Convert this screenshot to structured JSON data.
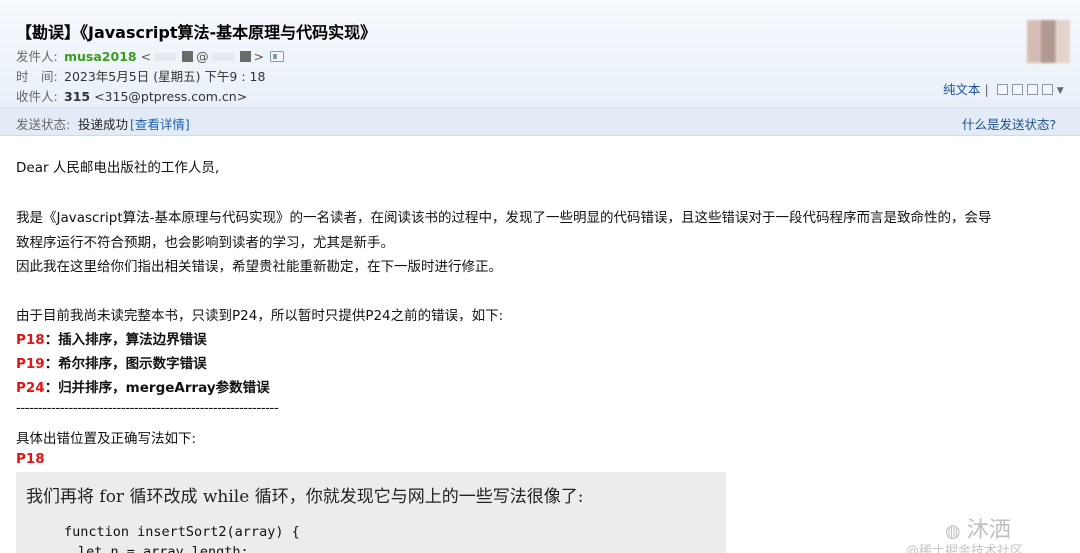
{
  "email": {
    "subject": "【勘误】《Javascript算法-基本原理与代码实现》",
    "star": "☆",
    "sender_label": "发件人:",
    "sender_name": "musa2018",
    "sender_addr_open": "<",
    "sender_at": "@",
    "sender_addr_close": ">",
    "time_label": "时　间:",
    "time_value": "2023年5月5日 (星期五) 下午9 : 18",
    "to_label": "收件人:",
    "to_value_name": "315",
    "to_value_addr": "<315@ptpress.com.cn>",
    "toolbar": {
      "plain_text": "纯文本",
      "sep": "|"
    },
    "status_label": "发送状态:",
    "status_value": "投递成功",
    "status_detail": "[查看详情]",
    "what_is_status": "什么是发送状态?"
  },
  "content": {
    "greeting": "Dear 人民邮电出版社的工作人员,",
    "para1a": "我是《Javascript算法-基本原理与代码实现》的一名读者，在阅读该书的过程中，发现了一些明显的代码错误，且这些错误对于一段代码程序而言是致命性的，会导",
    "para1b": "致程序运行不符合预期，也会影响到读者的学习，尤其是新手。",
    "para2": "因此我在这里给你们指出相关错误，希望贵社能重新勘定，在下一版时进行修正。",
    "para3": "由于目前我尚未读完整本书，只读到P24，所以暂时只提供P24之前的错误，如下:",
    "errors": [
      {
        "page": "P18",
        "desc": "：插入排序，算法边界错误"
      },
      {
        "page": "P19",
        "desc": "：希尔排序，图示数字错误"
      },
      {
        "page": "P24",
        "desc": "：归并排序，mergeArray参数错误"
      }
    ],
    "divider": "------------------------------------------------------------",
    "detail_intro": "具体出错位置及正确写法如下:",
    "section_page": "P18",
    "photo_text": "我们再将 for 循环改成 while 循环，你就发现它与网上的一些写法很像了:",
    "code_line1": "function insertSort2(array) {",
    "code_line2": "  let n = array.length;"
  },
  "watermark": {
    "line1": "沐洒",
    "line2": "@稀土掘金技术社区"
  }
}
